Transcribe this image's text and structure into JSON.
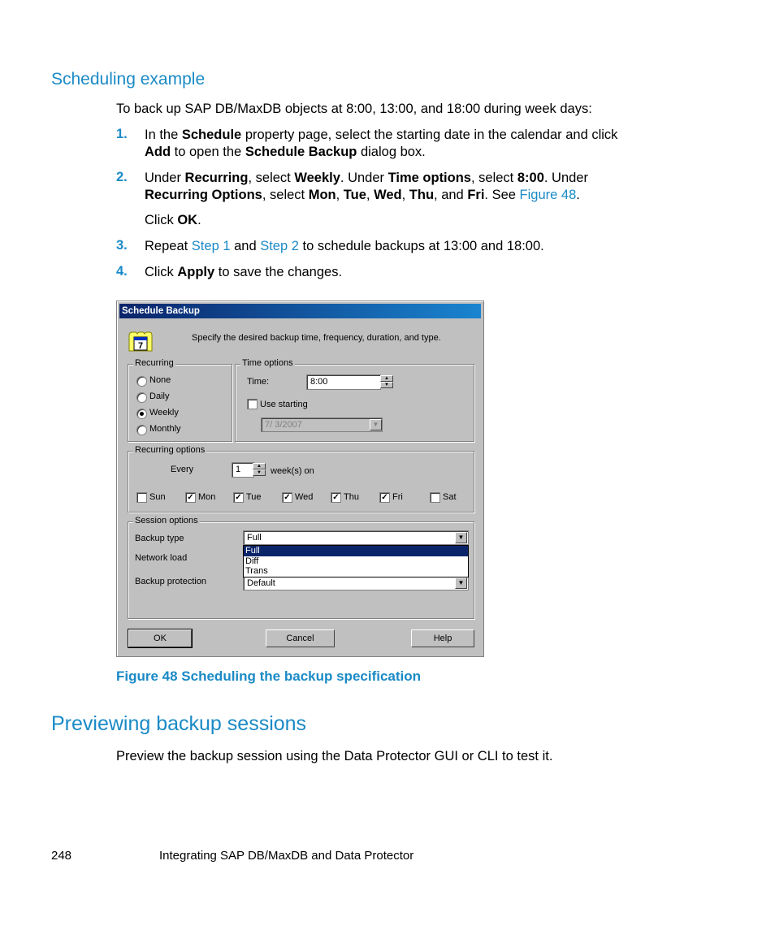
{
  "section": {
    "title": "Scheduling example",
    "intro": "To back up SAP DB/MaxDB objects at 8:00, 13:00, and 18:00 during week days:"
  },
  "steps": [
    {
      "num": "1.",
      "parts": [
        "In the ",
        "Schedule",
        " property page, select the starting date in the calendar and click ",
        "Add",
        " to open the ",
        "Schedule Backup",
        " dialog box."
      ]
    },
    {
      "num": "2.",
      "parts": [
        "Under ",
        "Recurring",
        ", select ",
        "Weekly",
        ". Under ",
        "Time options",
        ", select ",
        "8:00",
        ". Under ",
        "Recurring Options",
        ", select ",
        "Mon",
        ", ",
        "Tue",
        ", ",
        "Wed",
        ", ",
        "Thu",
        ", and ",
        "Fri",
        ". See ",
        "Figure 48",
        "."
      ],
      "sub": [
        "Click ",
        "OK",
        "."
      ]
    },
    {
      "num": "3.",
      "parts": [
        "Repeat ",
        "Step 1",
        " and ",
        "Step 2",
        " to schedule backups at 13:00 and 18:00."
      ]
    },
    {
      "num": "4.",
      "parts": [
        "Click ",
        "Apply",
        " to save the changes."
      ]
    }
  ],
  "dialog": {
    "title": "Schedule Backup",
    "description": "Specify the desired backup time, frequency, duration, and type.",
    "icon": "calendar-icon",
    "calendar_day": "7",
    "recurring": {
      "label": "Recurring",
      "options": [
        "None",
        "Daily",
        "Weekly",
        "Monthly"
      ],
      "selected": "Weekly"
    },
    "time_options": {
      "label": "Time options",
      "time_label": "Time:",
      "time_value": "8:00",
      "use_starting_label": "Use starting",
      "use_starting_checked": false,
      "date_value": "7/ 3/2007"
    },
    "recurring_options": {
      "label": "Recurring options",
      "every_label": "Every",
      "every_value": "1",
      "unit_label": "week(s) on",
      "days": [
        {
          "label": "Sun",
          "checked": false
        },
        {
          "label": "Mon",
          "checked": true
        },
        {
          "label": "Tue",
          "checked": true
        },
        {
          "label": "Wed",
          "checked": true
        },
        {
          "label": "Thu",
          "checked": true
        },
        {
          "label": "Fri",
          "checked": true
        },
        {
          "label": "Sat",
          "checked": false
        }
      ]
    },
    "session_options": {
      "label": "Session options",
      "backup_type_label": "Backup type",
      "backup_type_value": "Full",
      "backup_type_list": [
        "Full",
        "Diff",
        "Trans"
      ],
      "backup_type_highlight": "Full",
      "network_load_label": "Network load",
      "backup_protection_label": "Backup protection",
      "backup_protection_value": "Default"
    },
    "buttons": {
      "ok": "OK",
      "cancel": "Cancel",
      "help": "Help"
    }
  },
  "figure_caption": "Figure 48 Scheduling the backup specification",
  "preview": {
    "title": "Previewing backup sessions",
    "text": "Preview the backup session using the Data Protector GUI or CLI to test it."
  },
  "footer": {
    "page_number": "248",
    "chapter": "Integrating SAP DB/MaxDB and Data Protector"
  },
  "colors": {
    "accent": "#1a8ac6",
    "titlebar_start": "#0a246a",
    "titlebar_end": "#1a84d0",
    "dialog_bg": "#c0c0c0"
  }
}
